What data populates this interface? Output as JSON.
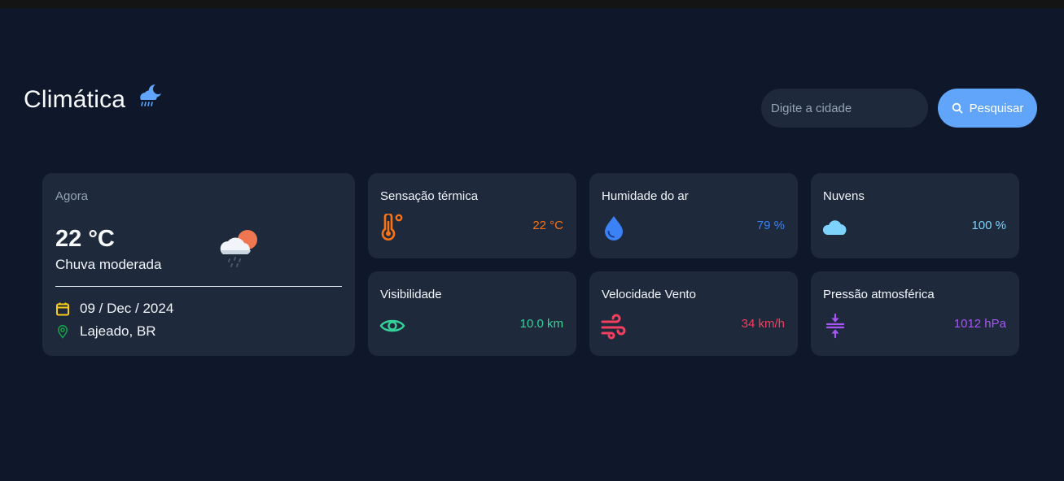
{
  "app": {
    "title": "Climática",
    "icon": "cloud-moon-rain-icon"
  },
  "search": {
    "placeholder": "Digite a cidade",
    "value": "",
    "button_label": "Pesquisar",
    "button_icon": "search-icon"
  },
  "current": {
    "label": "Agora",
    "temperature": "22 °C",
    "condition": "Chuva moderada",
    "icon": "cloud-sun-rain-icon",
    "date": "09 / Dec / 2024",
    "location": "Lajeado, BR",
    "date_icon": "calendar-icon",
    "location_icon": "map-pin-icon"
  },
  "stats": [
    {
      "title": "Sensação térmica",
      "value": "22 °C",
      "icon": "thermometer-icon",
      "color": "#f97316"
    },
    {
      "title": "Humidade do ar",
      "value": "79 %",
      "icon": "droplet-icon",
      "color": "#3b82f6"
    },
    {
      "title": "Nuvens",
      "value": "100 %",
      "icon": "cloud-icon",
      "color": "#7dd3fc"
    },
    {
      "title": "Visibilidade",
      "value": "10.0 km",
      "icon": "eye-icon",
      "color": "#34d399"
    },
    {
      "title": "Velocidade Vento",
      "value": "34 km/h",
      "icon": "wind-icon",
      "color": "#f43f5e"
    },
    {
      "title": "Pressão atmosférica",
      "value": "1012 hPa",
      "icon": "compress-icon",
      "color": "#a855f7"
    }
  ],
  "colors": {
    "background": "#0f172a",
    "card": "#1e293b",
    "accent": "#60a5fa"
  }
}
